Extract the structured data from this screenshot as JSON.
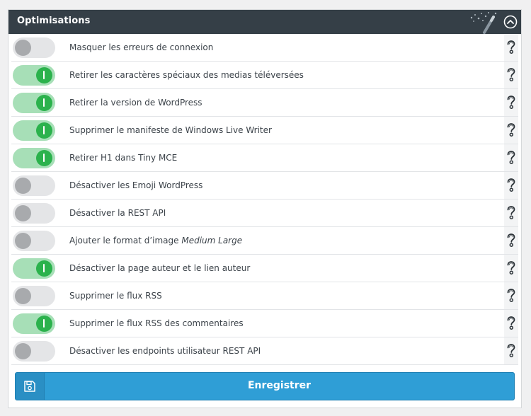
{
  "panel": {
    "title": "Optimisations",
    "wand_icon": "magic-wand-icon",
    "collapse_icon": "chevron-up-circle-icon"
  },
  "options": [
    {
      "label": "Masquer les erreurs de connexion",
      "enabled": false
    },
    {
      "label": "Retirer les caractères spéciaux des medias téléversées",
      "enabled": true
    },
    {
      "label": "Retirer la version de WordPress",
      "enabled": true
    },
    {
      "label": "Supprimer le manifeste de Windows Live Writer",
      "enabled": true
    },
    {
      "label": "Retirer H1 dans Tiny MCE",
      "enabled": true
    },
    {
      "label": "Désactiver les Emoji WordPress",
      "enabled": false
    },
    {
      "label": "Désactiver la REST API",
      "enabled": false
    },
    {
      "label": "Ajouter le format d’image ",
      "label_em": "Medium Large",
      "enabled": false
    },
    {
      "label": "Désactiver la page auteur et le lien auteur",
      "enabled": true
    },
    {
      "label": "Supprimer le flux RSS",
      "enabled": false
    },
    {
      "label": "Supprimer le flux RSS des commentaires",
      "enabled": true
    },
    {
      "label": "Désactiver les endpoints utilisateur REST API",
      "enabled": false
    }
  ],
  "help_icon": "question-mark-icon",
  "save": {
    "label": "Enregistrer",
    "icon": "floppy-disk-icon"
  },
  "colors": {
    "header_bg": "#353f47",
    "toggle_on_track": "#a7dfb7",
    "toggle_on_knob": "#2bb24c",
    "toggle_off_track": "#e4e5e7",
    "toggle_off_knob": "#a8aaad",
    "save_button": "#2f9ed6"
  }
}
